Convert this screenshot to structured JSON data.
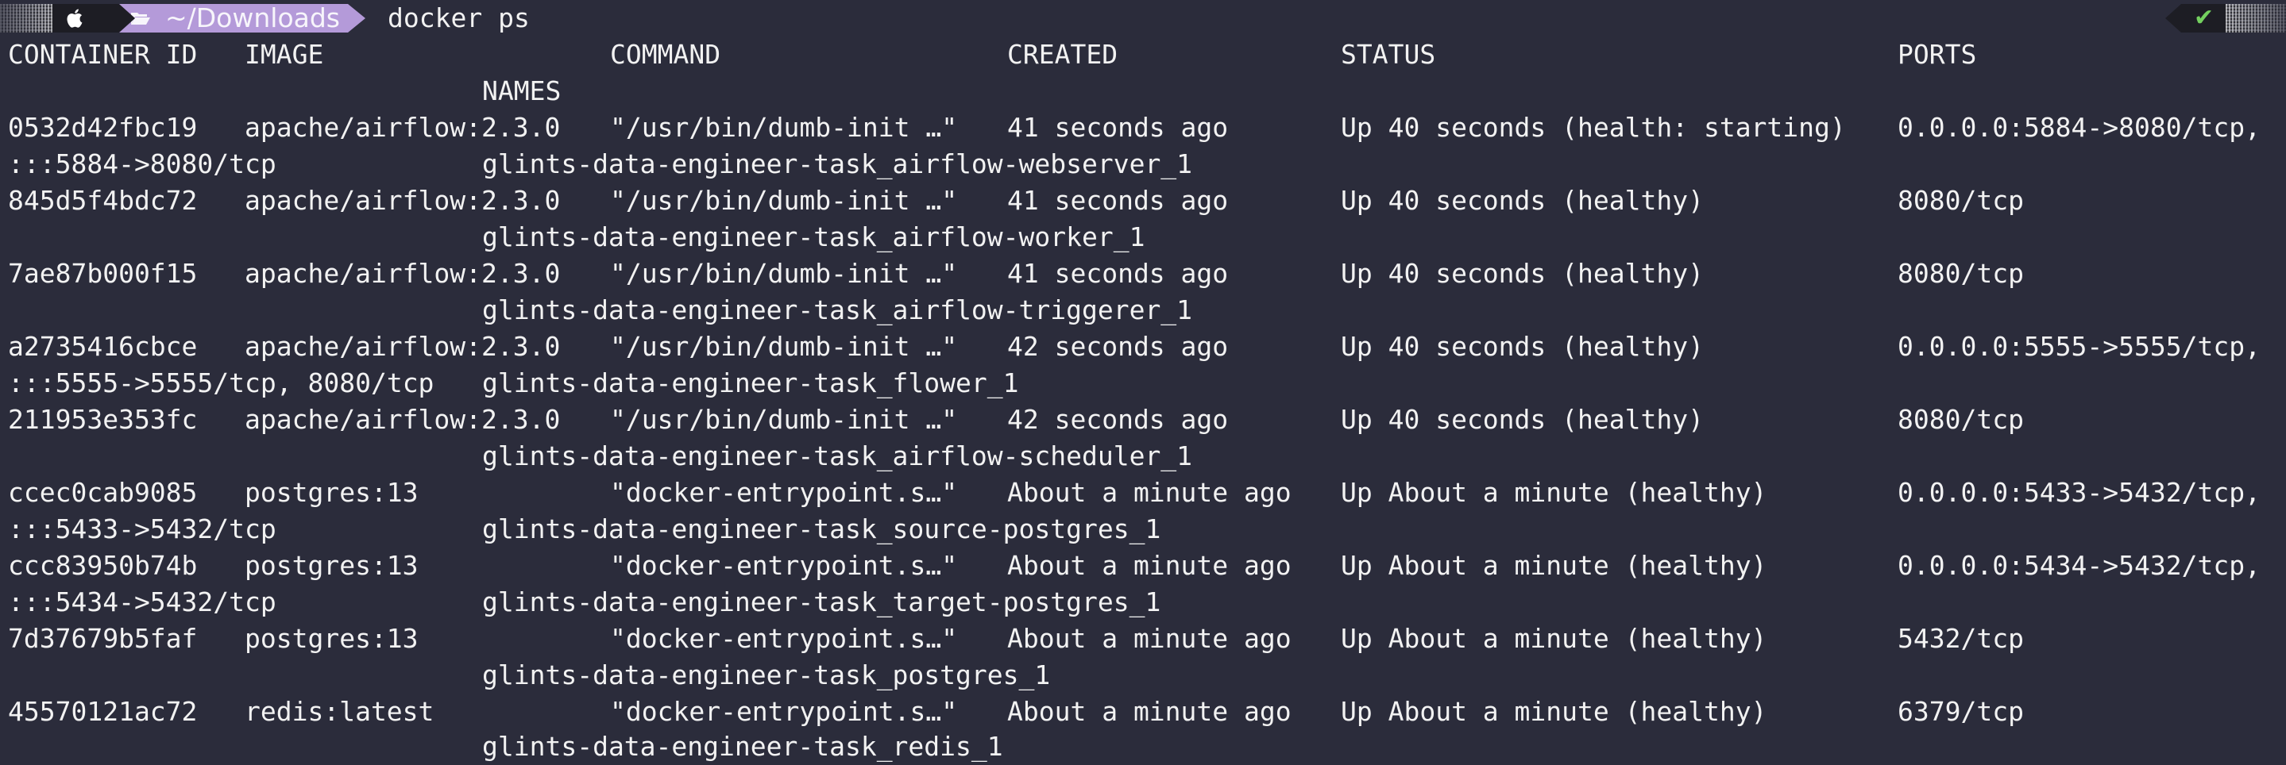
{
  "prompt": {
    "directory": "~/Downloads",
    "command": "docker ps",
    "status_symbol": "✔"
  },
  "colors": {
    "background": "#2b2c3b",
    "text": "#f2f2f2",
    "prompt_dir_bg": "#b49ad9",
    "prompt_icon_bg": "#1d1d24",
    "success": "#74d05f"
  },
  "headers": {
    "container_id": "CONTAINER ID",
    "image": "IMAGE",
    "command": "COMMAND",
    "created": "CREATED",
    "status": "STATUS",
    "ports": "PORTS",
    "names": "NAMES"
  },
  "containers": [
    {
      "id": "0532d42fbc19",
      "image": "apache/airflow:2.3.0",
      "command": "\"/usr/bin/dumb-init …\"",
      "created": "41 seconds ago",
      "status": "Up 40 seconds (health: starting)",
      "ports": "0.0.0.0:5884->8080/tcp,",
      "ports_cont": ":::5884->8080/tcp",
      "name": "glints-data-engineer-task_airflow-webserver_1"
    },
    {
      "id": "845d5f4bdc72",
      "image": "apache/airflow:2.3.0",
      "command": "\"/usr/bin/dumb-init …\"",
      "created": "41 seconds ago",
      "status": "Up 40 seconds (healthy)",
      "ports": "8080/tcp",
      "ports_cont": "",
      "name": "glints-data-engineer-task_airflow-worker_1"
    },
    {
      "id": "7ae87b000f15",
      "image": "apache/airflow:2.3.0",
      "command": "\"/usr/bin/dumb-init …\"",
      "created": "41 seconds ago",
      "status": "Up 40 seconds (healthy)",
      "ports": "8080/tcp",
      "ports_cont": "",
      "name": "glints-data-engineer-task_airflow-triggerer_1"
    },
    {
      "id": "a2735416cbce",
      "image": "apache/airflow:2.3.0",
      "command": "\"/usr/bin/dumb-init …\"",
      "created": "42 seconds ago",
      "status": "Up 40 seconds (healthy)",
      "ports": "0.0.0.0:5555->5555/tcp,",
      "ports_cont": ":::5555->5555/tcp, 8080/tcp",
      "name": "glints-data-engineer-task_flower_1"
    },
    {
      "id": "211953e353fc",
      "image": "apache/airflow:2.3.0",
      "command": "\"/usr/bin/dumb-init …\"",
      "created": "42 seconds ago",
      "status": "Up 40 seconds (healthy)",
      "ports": "8080/tcp",
      "ports_cont": "",
      "name": "glints-data-engineer-task_airflow-scheduler_1"
    },
    {
      "id": "ccec0cab9085",
      "image": "postgres:13",
      "command": "\"docker-entrypoint.s…\"",
      "created": "About a minute ago",
      "status": "Up About a minute (healthy)",
      "ports": "0.0.0.0:5433->5432/tcp,",
      "ports_cont": ":::5433->5432/tcp",
      "name": "glints-data-engineer-task_source-postgres_1"
    },
    {
      "id": "ccc83950b74b",
      "image": "postgres:13",
      "command": "\"docker-entrypoint.s…\"",
      "created": "About a minute ago",
      "status": "Up About a minute (healthy)",
      "ports": "0.0.0.0:5434->5432/tcp,",
      "ports_cont": ":::5434->5432/tcp",
      "name": "glints-data-engineer-task_target-postgres_1"
    },
    {
      "id": "7d37679b5faf",
      "image": "postgres:13",
      "command": "\"docker-entrypoint.s…\"",
      "created": "About a minute ago",
      "status": "Up About a minute (healthy)",
      "ports": "5432/tcp",
      "ports_cont": "",
      "name": "glints-data-engineer-task_postgres_1"
    },
    {
      "id": "45570121ac72",
      "image": "redis:latest",
      "command": "\"docker-entrypoint.s…\"",
      "created": "About a minute ago",
      "status": "Up About a minute (healthy)",
      "ports": "6379/tcp",
      "ports_cont": "",
      "name": "glints-data-engineer-task_redis_1"
    }
  ]
}
